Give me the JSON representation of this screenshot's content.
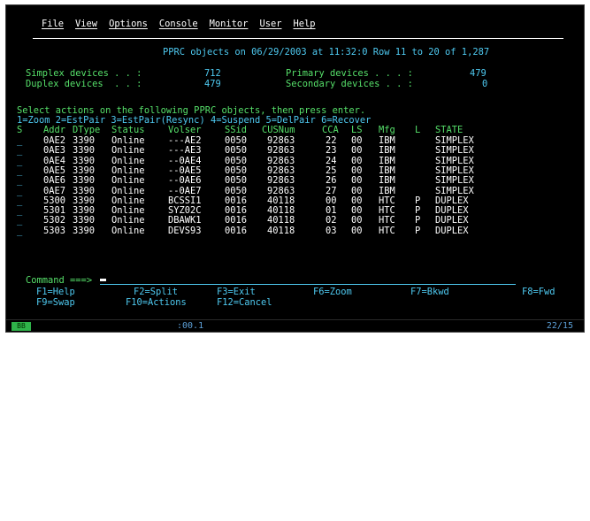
{
  "menu": {
    "items": [
      "File",
      "View",
      "Options",
      "Console",
      "Monitor",
      "User",
      "Help"
    ]
  },
  "header": {
    "title_line": "PPRC objects on 06/29/2003 at 11:32:0 Row 11 to 20 of 1,287"
  },
  "summary": {
    "simplex_label": "Simplex devices . . :",
    "simplex_value": "712",
    "duplex_label": "Duplex devices  . . :",
    "duplex_value": "479",
    "primary_label": "Primary devices . . . :",
    "primary_value": "479",
    "secondary_label": "Secondary devices . . :",
    "secondary_value": "0"
  },
  "instructions": {
    "line1": "Select actions on the following PPRC objects, then press enter.",
    "line2": "1=Zoom 2=EstPair 3=EstPair(Resync) 4=Suspend 5=DelPair 6=Recover"
  },
  "table": {
    "headers": [
      "S",
      "Addr",
      "DType",
      "Status",
      "Volser",
      "SSid",
      "CUSNum",
      "CCA",
      "LS",
      "Mfg",
      "L",
      "STATE"
    ],
    "rows": [
      [
        "_",
        "0AE2",
        "3390",
        "Online",
        "---AE2",
        "0050",
        "92863",
        "22",
        "00",
        "IBM",
        "",
        "SIMPLEX"
      ],
      [
        "_",
        "0AE3",
        "3390",
        "Online",
        "---AE3",
        "0050",
        "92863",
        "23",
        "00",
        "IBM",
        "",
        "SIMPLEX"
      ],
      [
        "_",
        "0AE4",
        "3390",
        "Online",
        "--0AE4",
        "0050",
        "92863",
        "24",
        "00",
        "IBM",
        "",
        "SIMPLEX"
      ],
      [
        "_",
        "0AE5",
        "3390",
        "Online",
        "--0AE5",
        "0050",
        "92863",
        "25",
        "00",
        "IBM",
        "",
        "SIMPLEX"
      ],
      [
        "_",
        "0AE6",
        "3390",
        "Online",
        "--0AE6",
        "0050",
        "92863",
        "26",
        "00",
        "IBM",
        "",
        "SIMPLEX"
      ],
      [
        "_",
        "0AE7",
        "3390",
        "Online",
        "--0AE7",
        "0050",
        "92863",
        "27",
        "00",
        "IBM",
        "",
        "SIMPLEX"
      ],
      [
        "_",
        "5300",
        "3390",
        "Online",
        "BCSSI1",
        "0016",
        "40118",
        "00",
        "00",
        "HTC",
        "P",
        "DUPLEX"
      ],
      [
        "_",
        "5301",
        "3390",
        "Online",
        "SYZ02C",
        "0016",
        "40118",
        "01",
        "00",
        "HTC",
        "P",
        "DUPLEX"
      ],
      [
        "_",
        "5302",
        "3390",
        "Online",
        "DBAWK1",
        "0016",
        "40118",
        "02",
        "00",
        "HTC",
        "P",
        "DUPLEX"
      ],
      [
        "_",
        "5303",
        "3390",
        "Online",
        "DEVS93",
        "0016",
        "40118",
        "03",
        "00",
        "HTC",
        "P",
        "DUPLEX"
      ]
    ]
  },
  "command": {
    "label": "Command ===>",
    "value": ""
  },
  "function_keys": {
    "row1": [
      "F1=Help",
      "F2=Split",
      "F3=Exit",
      "F6=Zoom",
      "F7=Bkwd",
      "F8=Fwd"
    ],
    "row2": [
      "F9=Swap",
      "F10=Actions",
      "F12=Cancel"
    ]
  },
  "status": {
    "box": "BB",
    "mid": ":00.1",
    "right": "22/15"
  },
  "colors": {
    "background": "#000000",
    "cyan": "#4ec9f0",
    "green": "#56e06a",
    "yellow": "#f7f44f",
    "white": "#ffffff"
  }
}
